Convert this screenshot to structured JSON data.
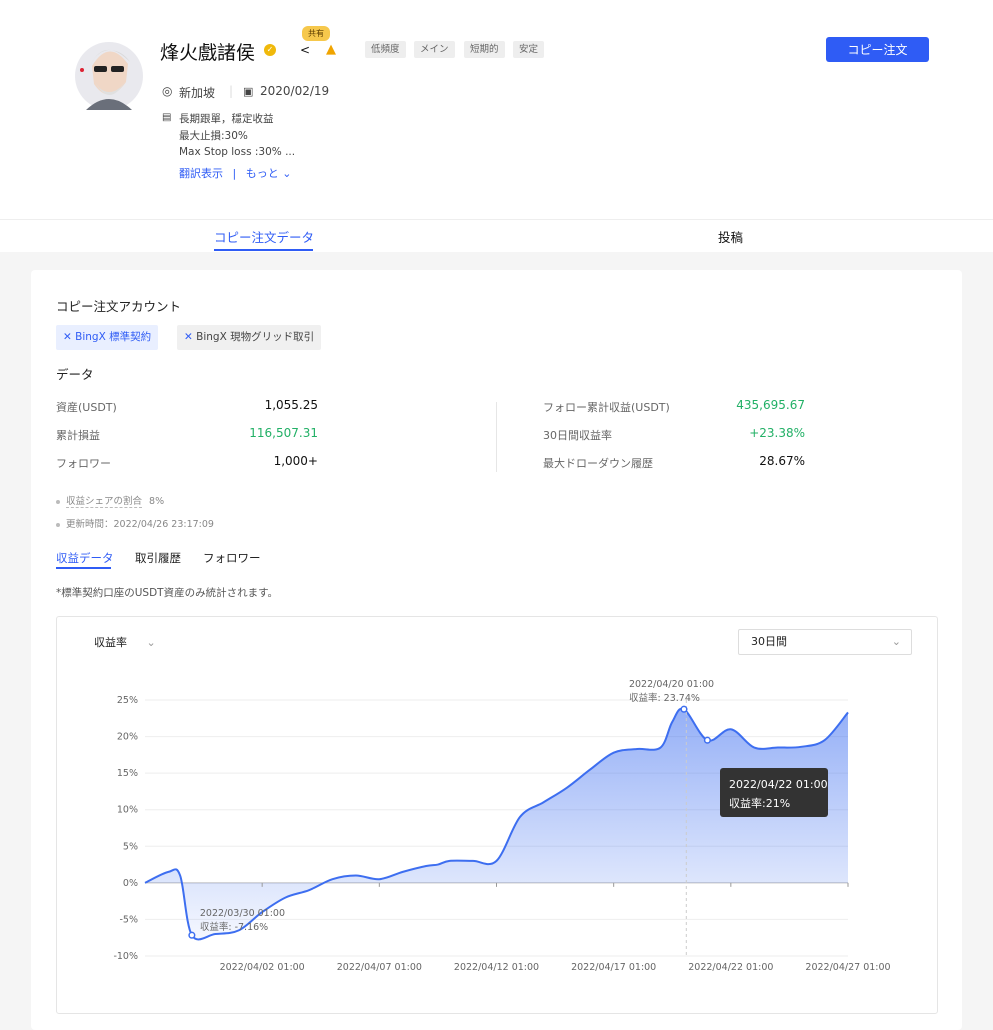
{
  "profile": {
    "name": "烽火戲諸侯",
    "shared_badge": "共有",
    "tags": [
      "低頻度",
      "メイン",
      "短期的",
      "安定"
    ],
    "copy_button": "コピー注文",
    "location": "新加坡",
    "date": "2020/02/19",
    "bio": [
      "長期跟單，穩定收益",
      "最大止損:30%",
      "Max Stop loss :30% ..."
    ],
    "translate_link": "翻訳表示",
    "more_link": "もっと"
  },
  "nav": {
    "tabs": [
      "コピー注文データ",
      "投稿"
    ]
  },
  "account": {
    "title": "コピー注文アカウント",
    "buttons": [
      "BingX 標準契約",
      "BingX 現物グリッド取引"
    ]
  },
  "stats": {
    "title": "データ",
    "left": [
      {
        "label": "資産(USDT)",
        "value": "1,055.25"
      },
      {
        "label": "累計損益",
        "value": "116,507.31"
      },
      {
        "label": "フォロワー",
        "value": "1,000+"
      }
    ],
    "right": [
      {
        "label": "フォロー累計収益(USDT)",
        "value": "435,695.67"
      },
      {
        "label": "30日間収益率",
        "value": "+23.38%"
      },
      {
        "label": "最大ドローダウン履歴",
        "value": "28.67%"
      }
    ],
    "share_ratio_label": "収益シェアの割合",
    "share_ratio_value": "8%",
    "updated": "更新時間：2022/04/26 23:17:09"
  },
  "subtabs": [
    "収益データ",
    "取引履歴",
    "フォロワー"
  ],
  "chart_note": "*標準契約口座のUSDT資産のみ統計されます。",
  "chart_controls": {
    "metric": "収益率",
    "period": "30日間"
  },
  "annotations": {
    "max_date": "2022/04/20 01:00",
    "max_text": "収益率: 23.74%",
    "min_date": "2022/03/30 01:00",
    "min_text": "収益率: -7.16%"
  },
  "tooltip": {
    "date": "2022/04/22 01:00",
    "text": "収益率:21%"
  },
  "chart_data": {
    "type": "area",
    "title": "",
    "xlabel": "",
    "ylabel": "",
    "x_start": "2022/03/28 01:00",
    "x_ticks": [
      "2022/04/02 01:00",
      "2022/04/07 01:00",
      "2022/04/12 01:00",
      "2022/04/17 01:00",
      "2022/04/22 01:00",
      "2022/04/27 01:00"
    ],
    "y_ticks": [
      "25%",
      "20%",
      "15%",
      "10%",
      "5%",
      "0%",
      "-5%",
      "-10%"
    ],
    "ylim": [
      -10,
      25
    ],
    "grid": true,
    "color": "#3d6ef0",
    "x_days": [
      0,
      1,
      1.5,
      2,
      3,
      4,
      5,
      6,
      7,
      8,
      9,
      10,
      11,
      12,
      12.5,
      13,
      14,
      15,
      16,
      17,
      18,
      19,
      20,
      21,
      22,
      22.5,
      23,
      24,
      25,
      26,
      27,
      28,
      29,
      30
    ],
    "values": [
      0,
      1.5,
      1,
      -7.16,
      -7,
      -6.5,
      -4,
      -2,
      -1,
      0.5,
      1,
      0.5,
      1.5,
      2.3,
      2.5,
      3,
      3,
      3,
      9,
      11,
      13,
      15.5,
      17.8,
      18.3,
      18.5,
      22,
      23.74,
      19.5,
      21,
      18.5,
      18.5,
      18.6,
      19.5,
      23.3
    ]
  }
}
